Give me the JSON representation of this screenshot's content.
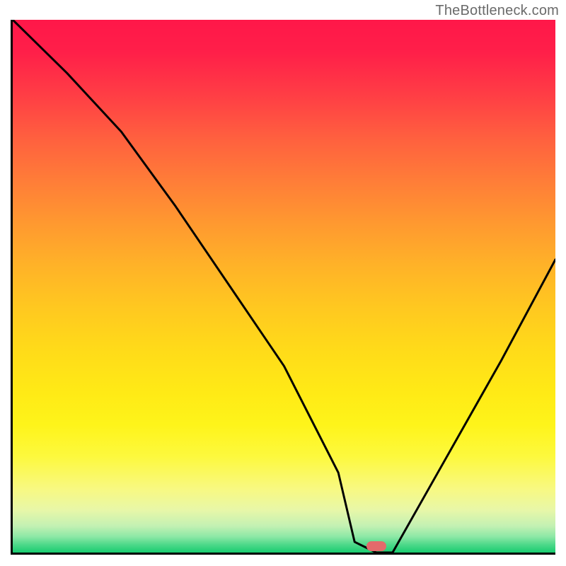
{
  "watermark": "TheBottleneck.com",
  "marker": {
    "position_pct": 67
  },
  "chart_data": {
    "type": "line",
    "title": "",
    "xlabel": "",
    "ylabel": "",
    "xlim": [
      0,
      100
    ],
    "ylim": [
      0,
      100
    ],
    "x": [
      0,
      10,
      20,
      30,
      40,
      50,
      60,
      63,
      67,
      70,
      80,
      90,
      100
    ],
    "values": [
      100,
      90,
      79,
      65,
      50,
      35,
      15,
      2,
      0,
      0,
      18,
      36,
      55
    ],
    "description": "V-shaped curve on a red-to-green vertical gradient; minimum near x≈67% marked with a pink pill on the x-axis."
  },
  "colors": {
    "curve": "#000000",
    "axes": "#000000",
    "marker": "#e46a6b",
    "watermark": "#6a6a6a"
  }
}
